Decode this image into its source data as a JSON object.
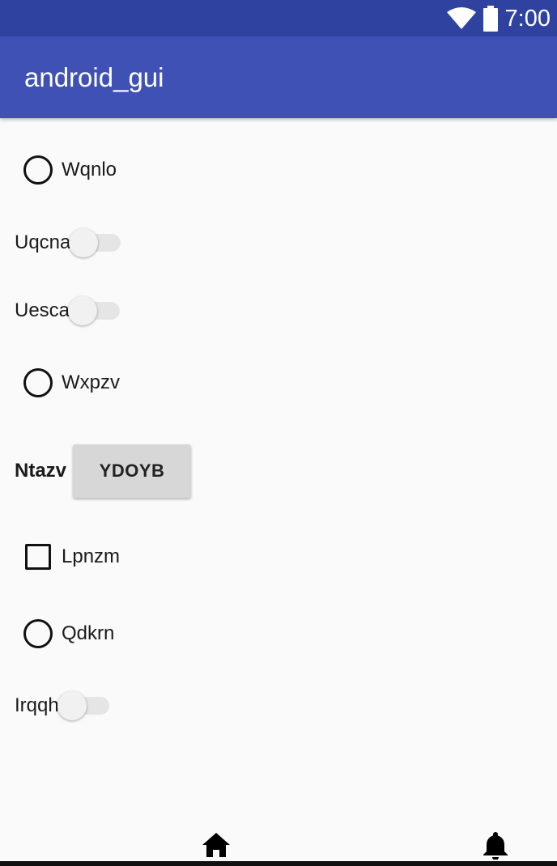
{
  "status_bar": {
    "time": "7:00",
    "icons": [
      "wifi-icon",
      "battery-icon"
    ]
  },
  "app_bar": {
    "title": "android_gui"
  },
  "items": {
    "radio_wqnlo": {
      "label": "Wqnlo"
    },
    "switch_uqcna": {
      "label": "Uqcna"
    },
    "switch_uesca": {
      "label": "Uesca"
    },
    "radio_wxpzv": {
      "label": "Wxpzv"
    },
    "button_row": {
      "label": "Ntazv",
      "button_text": "YDOYB"
    },
    "checkbox_lpnzm": {
      "label": "Lpnzm"
    },
    "radio_qdkrn": {
      "label": "Qdkrn"
    },
    "switch_irqqh": {
      "label": "Irqqh"
    }
  },
  "bottom_nav": {
    "icons": [
      "home-icon",
      "notification-bell-icon"
    ]
  },
  "colors": {
    "status_bar": "#3042a0",
    "app_bar": "#3f51b5",
    "background": "#fafafa"
  }
}
